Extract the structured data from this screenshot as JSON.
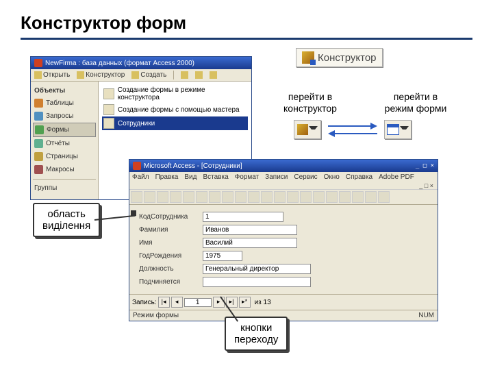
{
  "title": "Конструктор форм",
  "db_window": {
    "title": "NewFirma : база данных (формат Access 2000)",
    "toolbar": {
      "open": "Открыть",
      "design": "Конструктор",
      "create": "Создать"
    },
    "sidebar": {
      "header": "Объекты",
      "items": [
        {
          "label": "Таблицы",
          "color": "#d08030"
        },
        {
          "label": "Запросы",
          "color": "#5090c0"
        },
        {
          "label": "Формы",
          "color": "#50a050",
          "active": true
        },
        {
          "label": "Отчёты",
          "color": "#60b090"
        },
        {
          "label": "Страницы",
          "color": "#c0a040"
        },
        {
          "label": "Макросы",
          "color": "#a05050"
        }
      ],
      "footer": "Группы"
    },
    "main": [
      {
        "label": "Создание формы в режиме конструктора"
      },
      {
        "label": "Создание формы с помощью мастера"
      },
      {
        "label": "Сотрудники",
        "selected": true
      }
    ]
  },
  "konstruktor_btn": "Конструктор",
  "label_left": "перейти в\nконструктор",
  "label_right": "перейти в\nрежим форми",
  "form_window": {
    "title": "Microsoft Access - [Сотрудники]",
    "menu": [
      "Файл",
      "Правка",
      "Вид",
      "Вставка",
      "Формат",
      "Записи",
      "Сервис",
      "Окно",
      "Справка",
      "Adobe PDF"
    ],
    "fields": [
      {
        "label": "КодСотрудника",
        "value": "1",
        "w": "110"
      },
      {
        "label": "Фамилия",
        "value": "Иванов",
        "w": "130"
      },
      {
        "label": "Имя",
        "value": "Василий",
        "w": "130"
      },
      {
        "label": "ГодРождения",
        "value": "1975",
        "w": "50"
      },
      {
        "label": "Должность",
        "value": "Генеральный директор",
        "w": "150"
      },
      {
        "label": "Подчиняется",
        "value": "",
        "w": "150"
      }
    ],
    "nav": {
      "label": "Запись:",
      "pos": "1",
      "total": "из 13"
    },
    "status": {
      "left": "Режим формы",
      "right": "NUM"
    }
  },
  "callouts": {
    "selection": "область\nвиділення",
    "nav": "кнопки\nпереходу"
  }
}
